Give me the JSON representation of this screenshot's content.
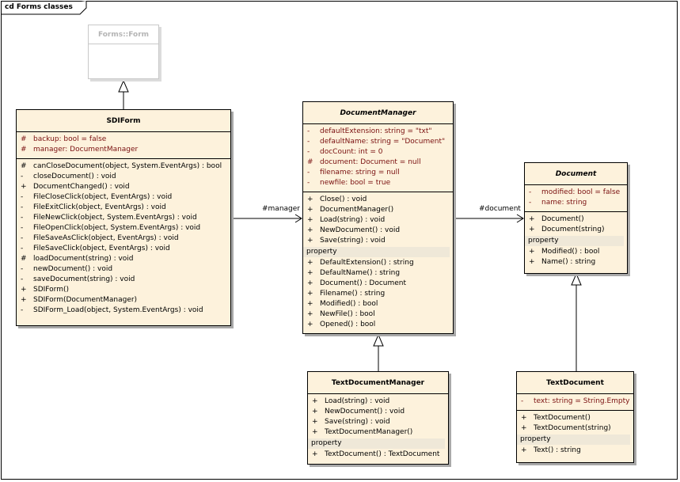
{
  "diagram": {
    "title": "cd Forms classes"
  },
  "classes": {
    "form": {
      "name": "Forms::Form"
    },
    "sdiform": {
      "name": "SDIForm",
      "attributes": [
        {
          "vis": "#",
          "text": "backup:  bool = false"
        },
        {
          "vis": "#",
          "text": "manager:  DocumentManager"
        }
      ],
      "operations": [
        {
          "vis": "#",
          "text": "canCloseDocument(object, System.EventArgs) : bool"
        },
        {
          "vis": "-",
          "text": "closeDocument() : void"
        },
        {
          "vis": "+",
          "text": "DocumentChanged() : void"
        },
        {
          "vis": "-",
          "text": "FileCloseClick(object, EventArgs) : void"
        },
        {
          "vis": "-",
          "text": "FileExitClick(object, EventArgs) : void"
        },
        {
          "vis": "-",
          "text": "FileNewClick(object, System.EventArgs) : void"
        },
        {
          "vis": "-",
          "text": "FileOpenClick(object, System.EventArgs) : void"
        },
        {
          "vis": "-",
          "text": "FileSaveAsClick(object, EventArgs) : void"
        },
        {
          "vis": "-",
          "text": "FileSaveClick(object, EventArgs) : void"
        },
        {
          "vis": "#",
          "text": "loadDocument(string) : void"
        },
        {
          "vis": "-",
          "text": "newDocument() : void"
        },
        {
          "vis": "-",
          "text": "saveDocument(string) : void"
        },
        {
          "vis": "+",
          "text": "SDIForm()"
        },
        {
          "vis": "+",
          "text": "SDIForm(DocumentManager)"
        },
        {
          "vis": "-",
          "text": "SDIForm_Load(object, System.EventArgs) : void"
        }
      ]
    },
    "documentmanager": {
      "name": "DocumentManager",
      "attributes": [
        {
          "vis": "-",
          "text": "defaultExtension:  string = \"txt\""
        },
        {
          "vis": "-",
          "text": "defaultName:  string = \"Document\""
        },
        {
          "vis": "-",
          "text": "docCount:  int = 0"
        },
        {
          "vis": "#",
          "text": "document:  Document = null"
        },
        {
          "vis": "-",
          "text": "filename:  string = null"
        },
        {
          "vis": "-",
          "text": "newfile:  bool = true"
        }
      ],
      "operations": [
        {
          "vis": "+",
          "text": "Close() : void"
        },
        {
          "vis": "+",
          "text": "DocumentManager()"
        },
        {
          "vis": "+",
          "text": "Load(string) : void"
        },
        {
          "vis": "+",
          "text": "NewDocument() : void"
        },
        {
          "vis": "+",
          "text": "Save(string) : void"
        }
      ],
      "stereotype": "property",
      "properties": [
        {
          "vis": "+",
          "text": "DefaultExtension() : string"
        },
        {
          "vis": "+",
          "text": "DefaultName() : string"
        },
        {
          "vis": "+",
          "text": "Document() : Document"
        },
        {
          "vis": "+",
          "text": "Filename() : string"
        },
        {
          "vis": "+",
          "text": "Modified() : bool"
        },
        {
          "vis": "+",
          "text": "NewFile() : bool"
        },
        {
          "vis": "+",
          "text": "Opened() : bool"
        }
      ]
    },
    "document": {
      "name": "Document",
      "attributes": [
        {
          "vis": "-",
          "text": "modified:  bool = false"
        },
        {
          "vis": "-",
          "text": "name:  string"
        }
      ],
      "operations": [
        {
          "vis": "+",
          "text": "Document()"
        },
        {
          "vis": "+",
          "text": "Document(string)"
        }
      ],
      "stereotype": "property",
      "properties": [
        {
          "vis": "+",
          "text": "Modified() : bool"
        },
        {
          "vis": "+",
          "text": "Name() : string"
        }
      ]
    },
    "textdocumentmanager": {
      "name": "TextDocumentManager",
      "operations": [
        {
          "vis": "+",
          "text": "Load(string) : void"
        },
        {
          "vis": "+",
          "text": "NewDocument() : void"
        },
        {
          "vis": "+",
          "text": "Save(string) : void"
        },
        {
          "vis": "+",
          "text": "TextDocumentManager()"
        }
      ],
      "stereotype": "property",
      "properties": [
        {
          "vis": "+",
          "text": "TextDocument() : TextDocument"
        }
      ]
    },
    "textdocument": {
      "name": "TextDocument",
      "attributes": [
        {
          "vis": "-",
          "text": "text:  string = String.Empty"
        }
      ],
      "operations": [
        {
          "vis": "+",
          "text": "TextDocument()"
        },
        {
          "vis": "+",
          "text": "TextDocument(string)"
        }
      ],
      "stereotype": "property",
      "properties": [
        {
          "vis": "+",
          "text": "Text() : string"
        }
      ]
    }
  },
  "associations": {
    "manager": "#manager",
    "document": "#document"
  }
}
